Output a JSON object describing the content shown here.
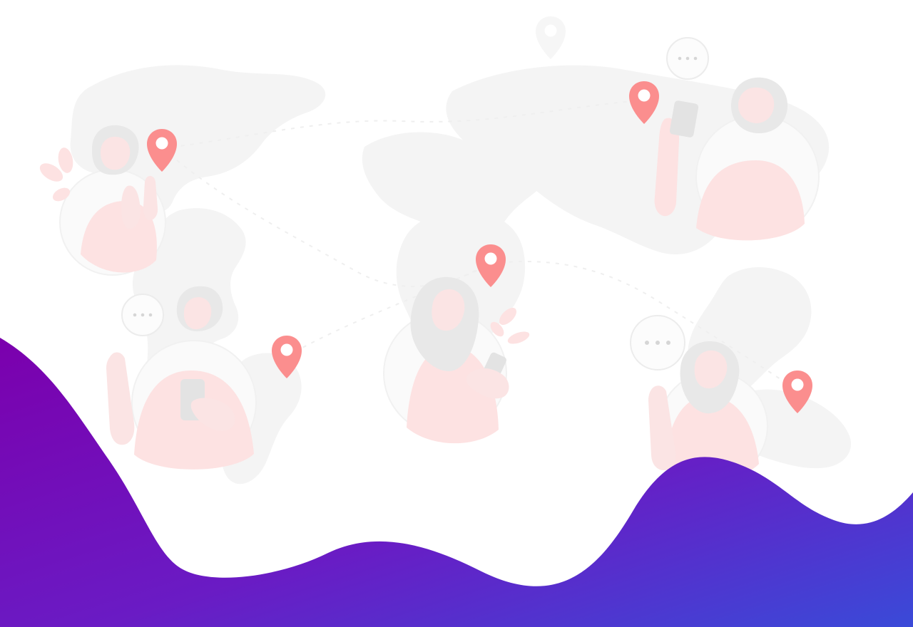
{
  "colors": {
    "background": "#ffffff",
    "map": "#f4f4f4",
    "skin_light": "#fbe4e4",
    "shirt": "#fde2e2",
    "pin": "#fb8e8e",
    "hair": "#e8e8e8",
    "dots": "#d6d6d6",
    "wave_start": "#7b00ad",
    "wave_mid": "#6a1bc4",
    "wave_end": "#3a4ad8"
  },
  "icons": {
    "map": "world-map",
    "pins": [
      "location-pin",
      "location-pin",
      "location-pin",
      "location-pin",
      "location-pin",
      "location-pin"
    ],
    "bubbles": [
      "typing-bubble",
      "typing-bubble",
      "typing-bubble"
    ]
  },
  "scene": {
    "people": [
      "person-left-top",
      "person-left-bottom",
      "person-center",
      "person-right-top",
      "person-right-bottom"
    ]
  }
}
